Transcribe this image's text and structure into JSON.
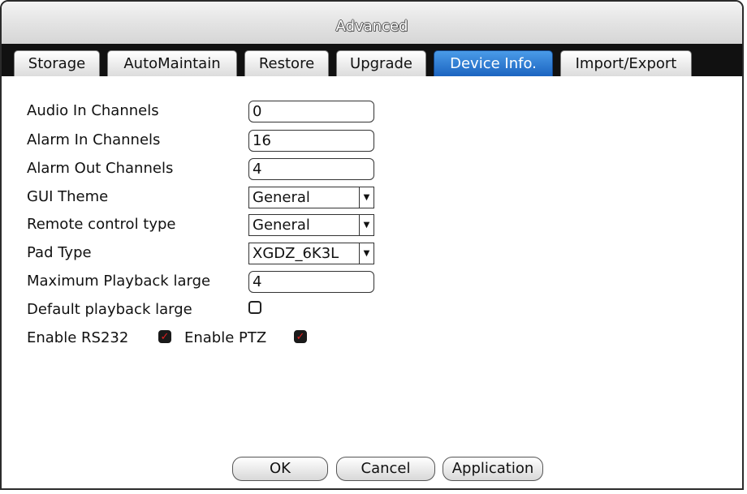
{
  "window": {
    "title": "Advanced"
  },
  "tabs": [
    {
      "label": "Storage"
    },
    {
      "label": "AutoMaintain"
    },
    {
      "label": "Restore"
    },
    {
      "label": "Upgrade"
    },
    {
      "label": "Device Info.",
      "active": true
    },
    {
      "label": "Import/Export"
    }
  ],
  "fields": {
    "audio_in": {
      "label": "Audio In Channels",
      "value": "0"
    },
    "alarm_in": {
      "label": "Alarm In Channels",
      "value": "16"
    },
    "alarm_out": {
      "label": "Alarm Out Channels",
      "value": "4"
    },
    "gui_theme": {
      "label": "GUI Theme",
      "value": "General"
    },
    "remote_control": {
      "label": "Remote control type",
      "value": "General"
    },
    "pad_type": {
      "label": "Pad Type",
      "value": "XGDZ_6K3L"
    },
    "max_playback": {
      "label": "Maximum Playback large",
      "value": "4"
    },
    "default_playback": {
      "label": "Default playback large",
      "checked": false
    },
    "rs232": {
      "label": "Enable RS232",
      "checked": true
    },
    "ptz": {
      "label": "Enable PTZ",
      "checked": true
    }
  },
  "buttons": {
    "ok": "OK",
    "cancel": "Cancel",
    "application": "Application"
  },
  "colors": {
    "active_tab": "#1c64c0",
    "tab_strip": "#111111",
    "check_mark": "#e02020"
  }
}
